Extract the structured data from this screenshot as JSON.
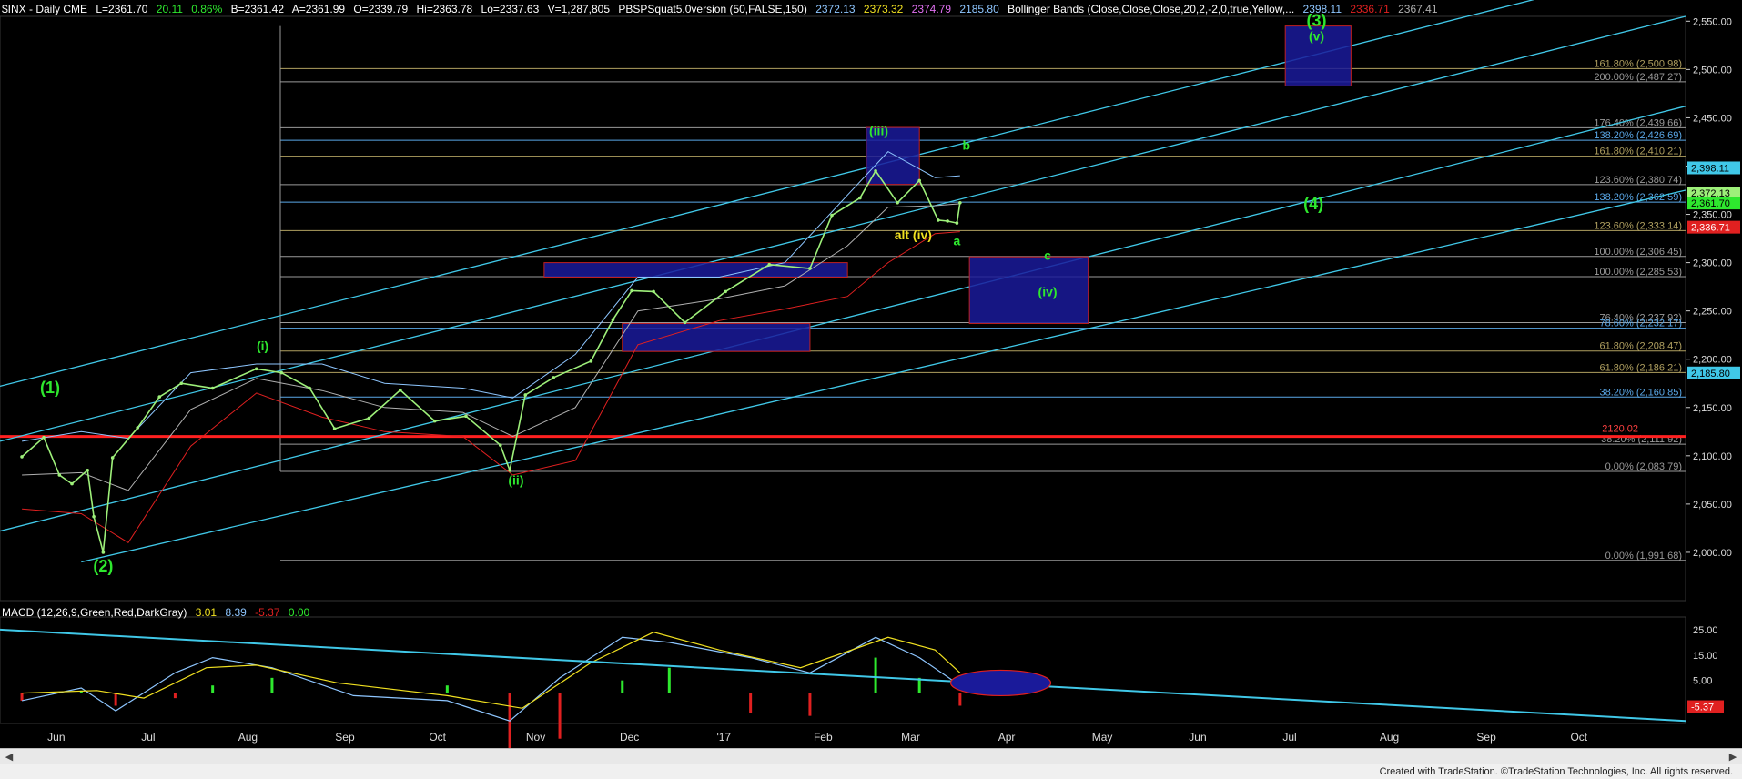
{
  "header": {
    "symbol": "$INX - Daily  CME",
    "last": "L=2361.70",
    "change": "20.11",
    "pct": "0.86%",
    "bid": "B=2361.42",
    "ask": "A=2361.99",
    "open": "O=2339.79",
    "high": "Hi=2363.78",
    "low": "Lo=2337.63",
    "volume": "V=1,287,805",
    "study1": "PBSPSquat5.0version (50,FALSE,150)",
    "study1_vals": [
      "2372.13",
      "2373.32",
      "2374.79",
      "2185.80"
    ],
    "study2": "Bollinger Bands (Close,Close,Close,20,2,-2,0,true,Yellow,...",
    "study2_vals": [
      "2398.11",
      "2336.71",
      "2367.41"
    ]
  },
  "macd_header": {
    "name": "MACD (12,26,9,Green,Red,DarkGray)",
    "vals": [
      "3.01",
      "8.39",
      "-5.37",
      "0.00"
    ]
  },
  "colors": {
    "price": "#9ef07a",
    "upper_band": "#8ec6ff",
    "lower_band": "#e02020",
    "mid_band": "#b0b0b0",
    "channel": "#40c8e8",
    "fib_gray": "#9a9a9a",
    "fib_blue": "#5aa8e8",
    "fib_olive": "#b0a060",
    "box_fill": "#1a1a9a",
    "box_edge": "#c02020",
    "label_green": "#2ee82e",
    "label_yellow": "#f0e020",
    "macd_line": "#8ec6ff",
    "signal_line": "#f0e020",
    "hist_pos": "#2ee82e",
    "hist_neg": "#e02020"
  },
  "chart_data": {
    "type": "line",
    "title": "$INX - Daily CME",
    "ylim": [
      1950,
      2555
    ],
    "yticks": [
      2000,
      2050,
      2100,
      2150,
      2200,
      2250,
      2300,
      2350,
      2400,
      2450,
      2500,
      2550
    ],
    "ytick_labels": [
      "2,000.00",
      "2,050.00",
      "2,100.00",
      "2,150.00",
      "2,200.00",
      "2,250.00",
      "2,300.00",
      "2,350.00",
      "2,400.00",
      "2,450.00",
      "2,500.00",
      "2,550.00"
    ],
    "x_months": [
      "Jun",
      "Jul",
      "Aug",
      "Sep",
      "Oct",
      "Nov",
      "Dec",
      "'17",
      "Feb",
      "Mar",
      "Apr",
      "May",
      "Jun",
      "Jul",
      "Aug",
      "Sep",
      "Oct"
    ],
    "price": [
      [
        "2016-06-01",
        2099
      ],
      [
        "2016-06-08",
        2119
      ],
      [
        "2016-06-13",
        2080
      ],
      [
        "2016-06-17",
        2071
      ],
      [
        "2016-06-22",
        2085
      ],
      [
        "2016-06-24",
        2037
      ],
      [
        "2016-06-27",
        2000
      ],
      [
        "2016-06-30",
        2098
      ],
      [
        "2016-07-08",
        2129
      ],
      [
        "2016-07-15",
        2161
      ],
      [
        "2016-07-22",
        2175
      ],
      [
        "2016-08-01",
        2170
      ],
      [
        "2016-08-15",
        2190
      ],
      [
        "2016-08-23",
        2186
      ],
      [
        "2016-09-01",
        2170
      ],
      [
        "2016-09-09",
        2128
      ],
      [
        "2016-09-20",
        2139
      ],
      [
        "2016-09-30",
        2168
      ],
      [
        "2016-10-11",
        2136
      ],
      [
        "2016-10-21",
        2141
      ],
      [
        "2016-11-01",
        2111
      ],
      [
        "2016-11-04",
        2085
      ],
      [
        "2016-11-09",
        2163
      ],
      [
        "2016-11-18",
        2181
      ],
      [
        "2016-11-30",
        2198
      ],
      [
        "2016-12-07",
        2241
      ],
      [
        "2016-12-13",
        2271
      ],
      [
        "2016-12-20",
        2270
      ],
      [
        "2016-12-30",
        2238
      ],
      [
        "2017-01-12",
        2270
      ],
      [
        "2017-01-26",
        2298
      ],
      [
        "2017-02-08",
        2294
      ],
      [
        "2017-02-15",
        2349
      ],
      [
        "2017-02-24",
        2367
      ],
      [
        "2017-03-01",
        2395
      ],
      [
        "2017-03-08",
        2362
      ],
      [
        "2017-03-15",
        2385
      ],
      [
        "2017-03-21",
        2344
      ],
      [
        "2017-03-24",
        2343
      ],
      [
        "2017-03-27",
        2341
      ],
      [
        "2017-03-28",
        2362
      ]
    ],
    "upper_band": [
      [
        "2016-06-01",
        2115
      ],
      [
        "2016-06-20",
        2125
      ],
      [
        "2016-07-05",
        2118
      ],
      [
        "2016-07-25",
        2186
      ],
      [
        "2016-08-15",
        2195
      ],
      [
        "2016-09-05",
        2195
      ],
      [
        "2016-09-25",
        2175
      ],
      [
        "2016-10-20",
        2170
      ],
      [
        "2016-11-05",
        2160
      ],
      [
        "2016-11-25",
        2205
      ],
      [
        "2016-12-15",
        2285
      ],
      [
        "2017-01-10",
        2285
      ],
      [
        "2017-01-31",
        2300
      ],
      [
        "2017-02-20",
        2370
      ],
      [
        "2017-03-05",
        2415
      ],
      [
        "2017-03-20",
        2388
      ],
      [
        "2017-03-28",
        2390
      ]
    ],
    "lower_band": [
      [
        "2016-06-01",
        2045
      ],
      [
        "2016-06-20",
        2040
      ],
      [
        "2016-07-05",
        2010
      ],
      [
        "2016-07-25",
        2110
      ],
      [
        "2016-08-15",
        2165
      ],
      [
        "2016-09-05",
        2140
      ],
      [
        "2016-09-25",
        2125
      ],
      [
        "2016-10-20",
        2120
      ],
      [
        "2016-11-05",
        2080
      ],
      [
        "2016-11-25",
        2095
      ],
      [
        "2016-12-15",
        2215
      ],
      [
        "2017-01-10",
        2240
      ],
      [
        "2017-01-31",
        2252
      ],
      [
        "2017-02-20",
        2265
      ],
      [
        "2017-03-05",
        2300
      ],
      [
        "2017-03-20",
        2330
      ],
      [
        "2017-03-28",
        2332
      ]
    ],
    "fib_levels": [
      {
        "pct": "161.80%",
        "value": 2500.98,
        "label": "161.80% (2,500.98)",
        "color": "olive"
      },
      {
        "pct": "200.00%",
        "value": 2487.27,
        "label": "200.00% (2,487.27)",
        "color": "gray"
      },
      {
        "pct": "176.40%",
        "value": 2439.66,
        "label": "176.40% (2,439.66)",
        "color": "gray"
      },
      {
        "pct": "138.20%",
        "value": 2426.69,
        "label": "138.20% (2,426.69)",
        "color": "blue"
      },
      {
        "pct": "161.80%",
        "value": 2410.21,
        "label": "161.80% (2,410.21)",
        "color": "olive"
      },
      {
        "pct": "123.60%",
        "value": 2380.74,
        "label": "123.60% (2,380.74)",
        "color": "gray"
      },
      {
        "pct": "138.20%",
        "value": 2362.59,
        "label": "138.20% (2,362.59)",
        "color": "blue"
      },
      {
        "pct": "123.60%",
        "value": 2333.14,
        "label": "123.60% (2,333.14)",
        "color": "olive"
      },
      {
        "pct": "100.00%",
        "value": 2306.45,
        "label": "100.00% (2,306.45)",
        "color": "gray"
      },
      {
        "pct": "100.00%",
        "value": 2285.53,
        "label": "100.00% (2,285.53)",
        "color": "gray"
      },
      {
        "pct": "76.40%",
        "value": 2237.92,
        "label": "76.40% (2,237.92)",
        "color": "gray"
      },
      {
        "pct": "78.60%",
        "value": 2232.17,
        "label": "78.60% (2,232.17)",
        "color": "blue"
      },
      {
        "pct": "61.80%",
        "value": 2208.47,
        "label": "61.80% (2,208.47)",
        "color": "olive"
      },
      {
        "pct": "61.80%",
        "value": 2186.21,
        "label": "61.80% (2,186.21)",
        "color": "olive"
      },
      {
        "pct": "38.20%",
        "value": 2160.85,
        "label": "38.20% (2,160.85)",
        "color": "blue"
      },
      {
        "pct": "38.20%",
        "value": 2111.92,
        "label": "38.20% (2,111.92)",
        "color": "gray"
      },
      {
        "pct": "0.00%",
        "value": 2083.79,
        "label": "0.00% (2,083.79)",
        "color": "gray"
      },
      {
        "pct": "0.00%",
        "value": 1991.68,
        "label": "0.00% (1,991.68)",
        "color": "gray"
      }
    ],
    "red_line": {
      "value": 2120.02,
      "label": "2120.02"
    },
    "price_tags": [
      {
        "value": 2398.11,
        "label": "2,398.11",
        "bg": "#40c8e8",
        "fg": "#000"
      },
      {
        "value": 2372.13,
        "label": "2,372.13",
        "bg": "#9ef07a",
        "fg": "#000"
      },
      {
        "value": 2361.7,
        "label": "2,361.70",
        "bg": "#2ee82e",
        "fg": "#000"
      },
      {
        "value": 2336.71,
        "label": "2,336.71",
        "bg": "#e02020",
        "fg": "#fff"
      },
      {
        "value": 2185.8,
        "label": "2,185.80",
        "bg": "#40c8e8",
        "fg": "#000"
      }
    ],
    "target_boxes": [
      {
        "name": "box-wave-3",
        "x0": "2017-07-10",
        "x1": "2017-07-31",
        "y0": 2483,
        "y1": 2545
      },
      {
        "name": "box-wave-iii",
        "x0": "2017-02-26",
        "x1": "2017-03-15",
        "y0": 2381,
        "y1": 2440
      },
      {
        "name": "box-wave-iv-target",
        "x0": "2017-03-31",
        "x1": "2017-05-08",
        "y0": 2237,
        "y1": 2306
      },
      {
        "name": "box-support-upper",
        "x0": "2016-11-15",
        "x1": "2017-02-20",
        "y0": 2285,
        "y1": 2300
      },
      {
        "name": "box-support-lower",
        "x0": "2016-12-10",
        "x1": "2017-02-08",
        "y0": 2208,
        "y1": 2237
      }
    ],
    "wave_labels": [
      {
        "text": "(1)",
        "x": "2016-06-10",
        "y": 2165,
        "color": "green",
        "size": 18
      },
      {
        "text": "(2)",
        "x": "2016-06-27",
        "y": 1980,
        "color": "green",
        "size": 18
      },
      {
        "text": "(i)",
        "x": "2016-08-17",
        "y": 2209,
        "color": "green",
        "size": 14
      },
      {
        "text": "(ii)",
        "x": "2016-11-06",
        "y": 2070,
        "color": "green",
        "size": 14
      },
      {
        "text": "(iii)",
        "x": "2017-03-02",
        "y": 2432,
        "color": "green",
        "size": 14
      },
      {
        "text": "b",
        "x": "2017-03-30",
        "y": 2417,
        "color": "green",
        "size": 14
      },
      {
        "text": "alt (iv)",
        "x": "2017-03-13",
        "y": 2324,
        "color": "yellow",
        "size": 14
      },
      {
        "text": "a",
        "x": "2017-03-27",
        "y": 2318,
        "color": "green",
        "size": 14
      },
      {
        "text": "c",
        "x": "2017-04-25",
        "y": 2303,
        "color": "green",
        "size": 14
      },
      {
        "text": "(iv)",
        "x": "2017-04-25",
        "y": 2265,
        "color": "green",
        "size": 14
      },
      {
        "text": "(3)",
        "x": "2017-07-20",
        "y": 2545,
        "color": "green",
        "size": 18
      },
      {
        "text": "(v)",
        "x": "2017-07-20",
        "y": 2530,
        "color": "green",
        "size": 14
      },
      {
        "text": "(4)",
        "x": "2017-07-19",
        "y": 2355,
        "color": "green",
        "size": 18
      }
    ],
    "macd": {
      "ylim": [
        -12,
        30
      ],
      "yticks": [
        5,
        15,
        25
      ],
      "ytick_labels": [
        "5.00",
        "15.00",
        "25.00"
      ],
      "last_tag": "-5.37",
      "macd_line": [
        [
          "2016-06-01",
          -3
        ],
        [
          "2016-06-20",
          2
        ],
        [
          "2016-07-01",
          -7
        ],
        [
          "2016-07-20",
          8
        ],
        [
          "2016-08-01",
          14
        ],
        [
          "2016-08-20",
          10
        ],
        [
          "2016-09-15",
          -1
        ],
        [
          "2016-10-15",
          -3
        ],
        [
          "2016-11-04",
          -11
        ],
        [
          "2016-11-20",
          6
        ],
        [
          "2016-12-10",
          22
        ],
        [
          "2016-12-25",
          20
        ],
        [
          "2017-01-20",
          14
        ],
        [
          "2017-02-08",
          8
        ],
        [
          "2017-03-01",
          22
        ],
        [
          "2017-03-15",
          14
        ],
        [
          "2017-03-28",
          3
        ]
      ],
      "signal_line": [
        [
          "2016-06-01",
          0
        ],
        [
          "2016-06-25",
          1
        ],
        [
          "2016-07-10",
          -2
        ],
        [
          "2016-07-30",
          10
        ],
        [
          "2016-08-15",
          11
        ],
        [
          "2016-09-10",
          4
        ],
        [
          "2016-10-15",
          -1
        ],
        [
          "2016-11-08",
          -6
        ],
        [
          "2016-11-30",
          12
        ],
        [
          "2016-12-20",
          24
        ],
        [
          "2017-01-10",
          17
        ],
        [
          "2017-02-05",
          10
        ],
        [
          "2017-03-05",
          22
        ],
        [
          "2017-03-20",
          17
        ],
        [
          "2017-03-28",
          8
        ]
      ],
      "trendline": [
        [
          "2016-05-25",
          25
        ],
        [
          "2017-11-15",
          -11
        ]
      ],
      "ellipse": {
        "x": "2017-04-10",
        "y": 4,
        "label": ""
      }
    }
  },
  "footer": "Created with TradeStation. ©TradeStation Technologies, Inc. All rights reserved."
}
